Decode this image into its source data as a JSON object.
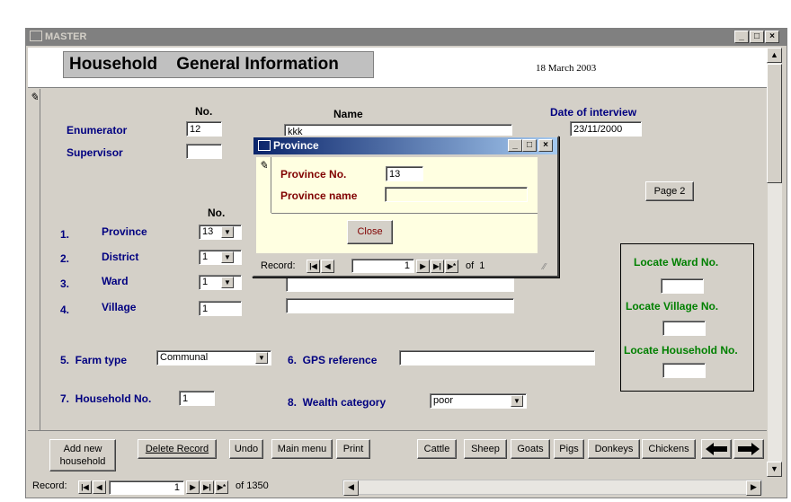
{
  "window": {
    "title": "MASTER",
    "controls": [
      "_",
      "□",
      "×"
    ]
  },
  "header": {
    "title": "Household    General Information",
    "date": "18 March 2003"
  },
  "form": {
    "col_no": "No.",
    "col_name": "Name",
    "date_label": "Date of interview",
    "date_value": "23/11/2000",
    "enumerator_label": "Enumerator",
    "enumerator_no": "12",
    "enumerator_name": "kkk",
    "supervisor_label": "Supervisor",
    "supervisor_no": "",
    "no2_label": "No.",
    "page2_button": "Page 2",
    "rows": [
      {
        "num": "1.",
        "label": "Province",
        "value": "13",
        "name": ""
      },
      {
        "num": "2.",
        "label": "District",
        "value": "1",
        "name": ""
      },
      {
        "num": "3.",
        "label": "Ward",
        "value": "1",
        "name": ""
      },
      {
        "num": "4.",
        "label": "Village",
        "value": "1",
        "name": ""
      }
    ],
    "farm_type_label": "5.  Farm type",
    "farm_type_value": "Communal",
    "gps_label": "6.  GPS reference",
    "gps_value": "",
    "household_label": "7.  Household No.",
    "household_value": "1",
    "wealth_label": "8.  Wealth category",
    "wealth_value": "poor"
  },
  "locate": {
    "ward": "Locate Ward No.",
    "village": "Locate Village No.",
    "household": "Locate Household No."
  },
  "buttons": {
    "add_new": "Add new household",
    "delete": "Delete Record",
    "undo": "Undo",
    "main_menu": "Main menu",
    "print": "Print",
    "cattle": "Cattle",
    "sheep": "Sheep",
    "goats": "Goats",
    "pigs": "Pigs",
    "donkeys": "Donkeys",
    "chickens": "Chickens"
  },
  "record_nav": {
    "label": "Record:",
    "current": "1",
    "of_text": "of 1350"
  },
  "dialog": {
    "title": "Province",
    "province_no_label": "Province No.",
    "province_no_value": "13",
    "province_name_label": "Province name",
    "province_name_value": "",
    "close_button": "Close",
    "record_label": "Record:",
    "record_current": "1",
    "record_of": "of  1"
  },
  "colors": {
    "title_inactive": "#808080",
    "dialog_title_start": "#0a246a",
    "label_blue": "#000080",
    "label_green": "#008000",
    "dialog_label": "#800000"
  }
}
